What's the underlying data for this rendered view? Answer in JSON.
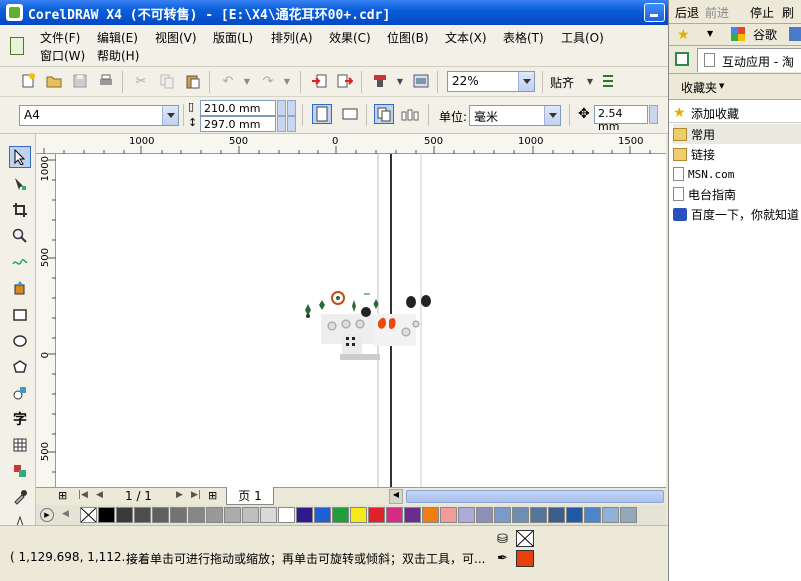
{
  "window": {
    "title": "CorelDRAW X4 (不可转售) - [E:\\X4\\通花耳环00+.cdr]"
  },
  "menu": {
    "row1": [
      "文件(F)",
      "编辑(E)",
      "视图(V)",
      "版面(L)",
      "排列(A)",
      "效果(C)",
      "位图(B)",
      "文本(X)",
      "表格(T)",
      "工具(O)"
    ],
    "row2": [
      "窗口(W)",
      "帮助(H)"
    ]
  },
  "toolbar": {
    "zoom": "22%",
    "snap_label": "贴齐"
  },
  "property_bar": {
    "paper_size": "A4",
    "width": "210.0 mm",
    "height": "297.0 mm",
    "unit_label": "单位:",
    "unit_value": "毫米",
    "nudge": "2.54 mm"
  },
  "ruler": {
    "h_labels": [
      "1000",
      "500",
      "0",
      "500",
      "1000",
      "1500"
    ],
    "v_labels": [
      "1000",
      "500",
      "0",
      "500"
    ]
  },
  "page_nav": {
    "counter": "1 / 1",
    "tab": "页 1"
  },
  "palette": {
    "colors": [
      "#000000",
      "#3a3a3a",
      "#4d4d4d",
      "#606060",
      "#737373",
      "#868686",
      "#999999",
      "#acacac",
      "#bfbfbf",
      "#d9d9d9",
      "#ffffff",
      "#2e1a8c",
      "#1f5fd6",
      "#1f9e3b",
      "#f5ea1a",
      "#e0212b",
      "#d62a87",
      "#6b2c8f",
      "#ef7d14",
      "#f39b9b",
      "#b0a8d6",
      "#8c8fb8",
      "#7a9ac8",
      "#6e8fb0",
      "#55759a",
      "#3b5f8a",
      "#1e5aa8",
      "#4a86c8",
      "#8fb2d6",
      "#93a8b8"
    ]
  },
  "status": {
    "coords": "( 1,129.698, 1,112....",
    "hint": "接着单击可进行拖动或缩放；再单击可旋转或倾斜；双击工具，可...",
    "fill_color": "#e8400c"
  },
  "browser_panel": {
    "nav": [
      "后退",
      "前进",
      "停止",
      "刷新"
    ],
    "bar2": "谷歌",
    "tab": "互动应用 - 淘",
    "favorites_title": "收藏夹",
    "add_favorite": "添加收藏",
    "items": [
      "常用",
      "链接",
      "MSN.com",
      "电台指南",
      "百度一下，你就知道"
    ]
  }
}
